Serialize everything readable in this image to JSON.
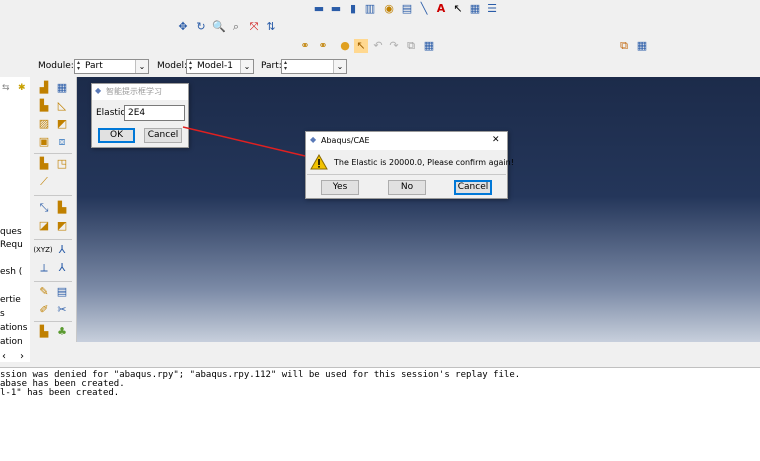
{
  "context_bar": {
    "module_label": "Module:",
    "module_value": "Part",
    "model_label": "Model:",
    "model_value": "Model-1",
    "part_label": "Part:",
    "part_value": ""
  },
  "tree": {
    "items": [
      "ques",
      "Requ",
      "esh (",
      "ertie",
      "s",
      "ations",
      "ation"
    ]
  },
  "prompt_dialog": {
    "title": "智能提示框学习",
    "field_label": "Elastic:",
    "field_value": "2E4",
    "ok_label": "OK",
    "cancel_label": "Cancel"
  },
  "confirm_dialog": {
    "title": "Abaqus/CAE",
    "message": "The Elastic is 20000.0, Please confirm again!",
    "yes_label": "Yes",
    "no_label": "No",
    "cancel_label": "Cancel",
    "close_glyph": "✕"
  },
  "message_area": {
    "lines": [
      "ssion was denied for \"abaqus.rpy\"; \"abaqus.rpy.112\" will be used for this session's replay file.",
      "abase has been created.",
      "l-1\" has been created."
    ]
  },
  "colors": {
    "viewport_top": "#1c2b4a",
    "viewport_bottom": "#c7cfdc",
    "arrow": "#e02020",
    "default_button_border": "#0078d7"
  }
}
